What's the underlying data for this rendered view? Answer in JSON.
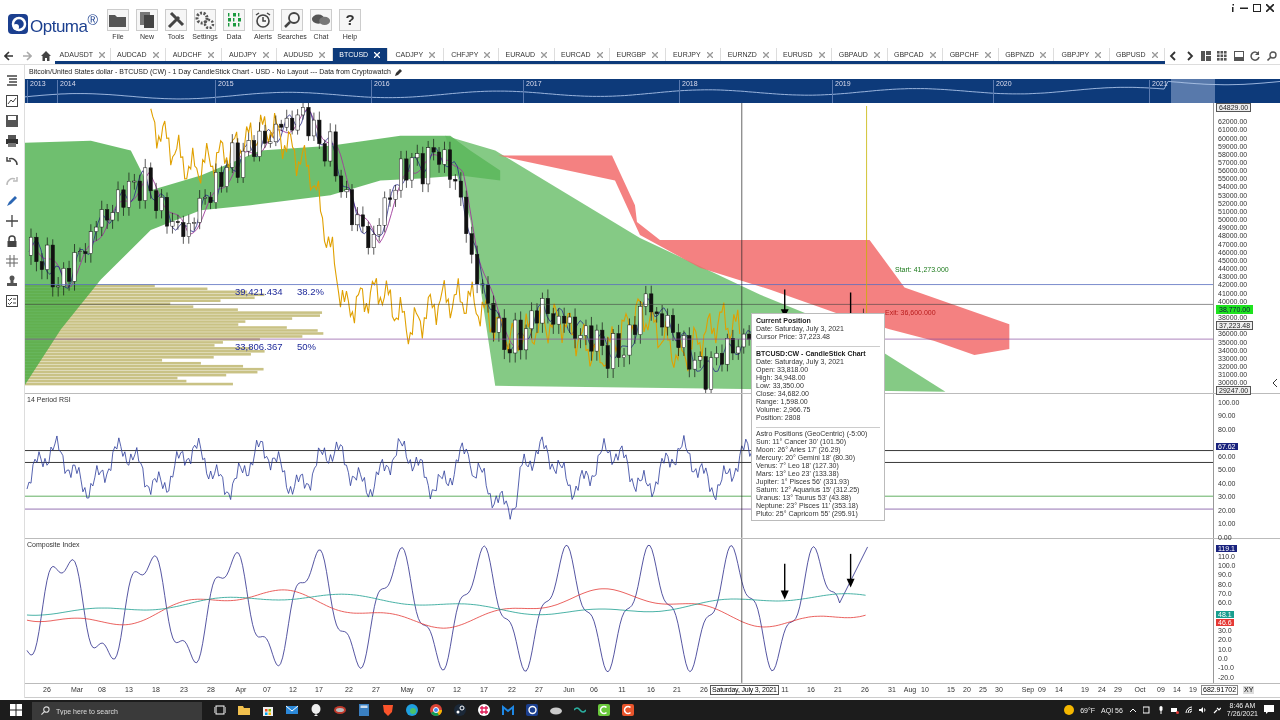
{
  "app": {
    "logo": "Optuma$^{®}$"
  },
  "toolbar": [
    {
      "kind": "file",
      "label": "File"
    },
    {
      "kind": "new",
      "label": "New"
    },
    {
      "kind": "tools",
      "label": "Tools"
    },
    {
      "kind": "settings",
      "label": "Settings"
    },
    {
      "kind": "data",
      "label": "Data"
    },
    {
      "kind": "alerts",
      "label": "Alerts"
    },
    {
      "kind": "searches",
      "label": "Searches"
    },
    {
      "kind": "chat",
      "label": "Chat"
    },
    {
      "kind": "help",
      "label": "Help",
      "glyph": "?"
    }
  ],
  "tabs": [
    {
      "label": "ADAUSDT",
      "selected": false
    },
    {
      "label": "AUDCAD",
      "selected": false
    },
    {
      "label": "AUDCHF",
      "selected": false
    },
    {
      "label": "AUDJPY",
      "selected": false
    },
    {
      "label": "AUDUSD",
      "selected": false
    },
    {
      "label": "BTCUSD",
      "selected": true
    },
    {
      "label": "CADJPY",
      "selected": false
    },
    {
      "label": "CHFJPY",
      "selected": false
    },
    {
      "label": "EURAUD",
      "selected": false
    },
    {
      "label": "EURCAD",
      "selected": false
    },
    {
      "label": "EURGBP",
      "selected": false
    },
    {
      "label": "EURJPY",
      "selected": false
    },
    {
      "label": "EURNZD",
      "selected": false
    },
    {
      "label": "EURUSD",
      "selected": false
    },
    {
      "label": "GBPAUD",
      "selected": false
    },
    {
      "label": "GBPCAD",
      "selected": false
    },
    {
      "label": "GBPCHF",
      "selected": false
    },
    {
      "label": "GBPNZD",
      "selected": false
    },
    {
      "label": "GBPJPY",
      "selected": false
    },
    {
      "label": "GBPUSD",
      "selected": false
    }
  ],
  "chart": {
    "title": "Bitcoin/United States dollar - BTCUSD (CW) - 1 Day CandleStick Chart - USD - No Layout --- Data from Cryptowatch",
    "navigator_years": [
      "2013",
      "2014",
      "2015",
      "2016",
      "2017",
      "2018",
      "2019",
      "2020",
      "2021"
    ],
    "price_ticks": [
      "62000.00",
      "61000.00",
      "60000.00",
      "59000.00",
      "58000.00",
      "57000.00",
      "56000.00",
      "55000.00",
      "54000.00",
      "53000.00",
      "52000.00",
      "51000.00",
      "50000.00",
      "49000.00",
      "48000.00",
      "47000.00",
      "46000.00",
      "45000.00",
      "44000.00",
      "43000.00",
      "42000.00",
      "41000.00",
      "40000.00",
      "38000.00",
      "36000.00",
      "35000.00",
      "34000.00",
      "33000.00",
      "32000.00",
      "31000.00",
      "30000.00"
    ],
    "price_markers": [
      {
        "kind": "high",
        "label": "64829.00"
      },
      {
        "kind": "last",
        "label": "38,770.00"
      },
      {
        "kind": "cursor",
        "label": "37,223.48"
      },
      {
        "kind": "low",
        "label": "29247.00"
      }
    ],
    "fib_levels": [
      {
        "price": "39,421.434",
        "percent": "38.2%"
      },
      {
        "price": "33,806.367",
        "percent": "50%"
      }
    ],
    "trade_labels": [
      {
        "kind": "start",
        "label": "Start: 41,273.000"
      },
      {
        "kind": "exit",
        "label": "Exit: 36,600.000"
      }
    ],
    "tooltip": {
      "sections": [
        {
          "title": "Current Position",
          "lines": [
            "Date: Saturday, July 3, 2021",
            "Cursor Price: 37,223.48"
          ]
        },
        {
          "title": "BTCUSD:CW - CandleStick Chart",
          "lines": [
            "Date: Saturday, July 3, 2021",
            "Open: 33,818.00",
            "High: 34,948.00",
            "Low: 33,350.00",
            "Close: 34,682.00",
            "Range: 1,598.00",
            "Volume: 2,966.75",
            "Position: 2808"
          ]
        },
        {
          "lines": [
            "Astro Positions (GeoCentric) (-5:00)",
            "Sun: 11° Cancer 30' (101.50)",
            "Moon: 26° Aries 17' (26.29)",
            "Mercury: 20° Gemini 18' (80.30)",
            "Venus: 7° Leo 18' (127.30)",
            "Mars: 13° Leo 23' (133.38)",
            "Jupiter: 1° Pisces 56' (331.93)",
            "Saturn: 12° Aquarius 15' (312.25)",
            "Uranus: 13° Taurus 53' (43.88)",
            "Neptune: 23° Pisces 11' (353.18)",
            "Pluto: 25° Capricorn 55' (295.91)"
          ]
        }
      ]
    },
    "rsi": {
      "title": "14 Period RSI",
      "ticks": [
        "100.00",
        "90.00",
        "80.00",
        "60.00",
        "50.00",
        "40.00",
        "30.00",
        "20.00",
        "10.00",
        "0.00"
      ],
      "markers": [
        {
          "label": "67.62",
          "color": "#1a237e"
        }
      ]
    },
    "composite": {
      "title": "Composite Index",
      "ticks": [
        "110.0",
        "100.0",
        "90.0",
        "80.0",
        "70.0",
        "60.0",
        "30.0",
        "20.0",
        "10.0",
        "0.0",
        "-10.0",
        "-20.0"
      ],
      "markers": [
        {
          "label": "119.1",
          "color": "#1a237e"
        },
        {
          "label": "48.1",
          "color": "#1a9e8f"
        },
        {
          "label": "46.6",
          "color": "#e53935"
        }
      ]
    },
    "date_axis": {
      "labels": [
        "26",
        "Mar",
        "08",
        "13",
        "18",
        "23",
        "28",
        "Apr",
        "07",
        "12",
        "17",
        "22",
        "27",
        "May",
        "07",
        "12",
        "17",
        "22",
        "27",
        "Jun",
        "06",
        "11",
        "16",
        "21",
        "26",
        "11",
        "16",
        "21",
        "26",
        "31",
        "Aug",
        "10",
        "15",
        "20",
        "25",
        "30",
        "Sep",
        "09",
        "14",
        "19",
        "24",
        "29",
        "Oct",
        "09",
        "14",
        "19"
      ],
      "cursor_date": "Saturday, July 3, 2021",
      "reading": "682.91702",
      "mode": "XY"
    }
  },
  "taskbar": {
    "search_placeholder": "Type here to search",
    "temperature": "69°F",
    "aqi": "AQI 56",
    "time": "8:46 AM",
    "date": "7/26/2021"
  }
}
